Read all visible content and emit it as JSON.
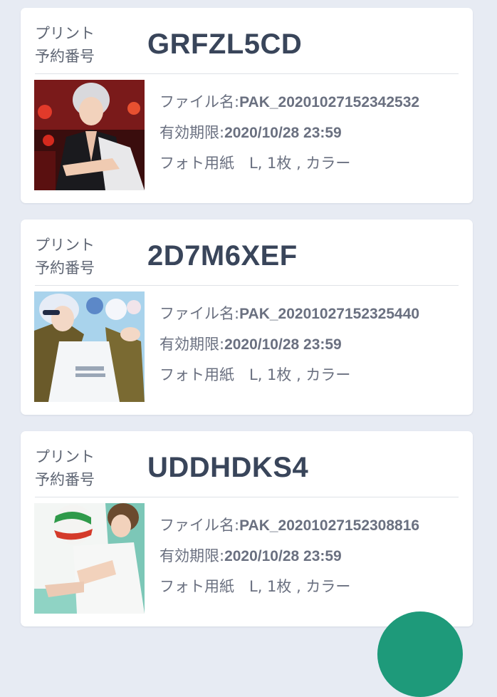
{
  "reservations": [
    {
      "label": "プリント\n予約番号",
      "code": "GRFZL5CD",
      "file_label": "ファイル名:",
      "file_name": "PAK_20201027152342532",
      "expiry_label": "有効期限:",
      "expiry": "2020/10/28 23:59",
      "paper_info": "フォト用紙　L, 1枚 , カラー"
    },
    {
      "label": "プリント\n予約番号",
      "code": "2D7M6XEF",
      "file_label": "ファイル名:",
      "file_name": "PAK_20201027152325440",
      "expiry_label": "有効期限:",
      "expiry": "2020/10/28 23:59",
      "paper_info": "フォト用紙　L, 1枚 , カラー"
    },
    {
      "label": "プリント\n予約番号",
      "code": "UDDHDKS4",
      "file_label": "ファイル名:",
      "file_name": "PAK_20201027152308816",
      "expiry_label": "有効期限:",
      "expiry": "2020/10/28 23:59",
      "paper_info": "フォト用紙　L, 1枚 , カラー"
    }
  ],
  "colors": {
    "background": "#e7ebf3",
    "card": "#ffffff",
    "code_text": "#39455a",
    "info_text": "#6a7080",
    "fab": "#1e9a7a"
  },
  "thumbnails": [
    {
      "icon": "anime-character-red-background-image"
    },
    {
      "icon": "anime-character-blue-background-image"
    },
    {
      "icon": "anime-character-volleyball-image"
    }
  ],
  "fab": {
    "icon": "floating-action-button"
  }
}
